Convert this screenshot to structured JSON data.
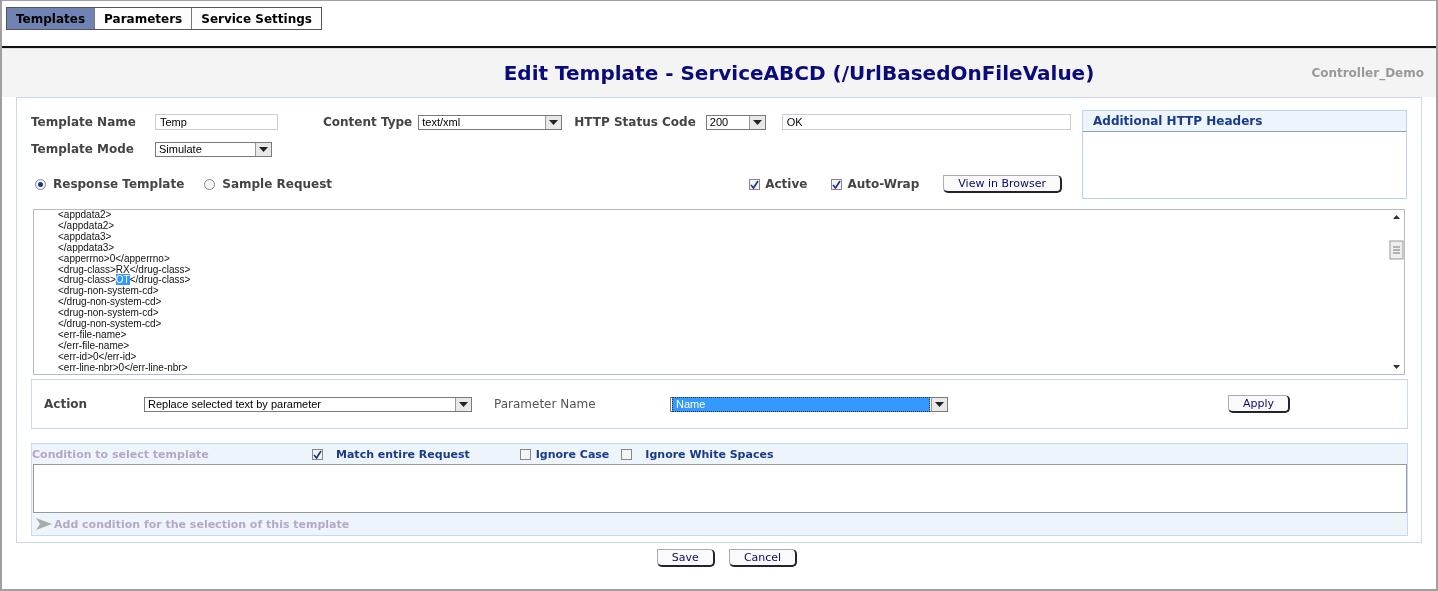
{
  "tabs": [
    {
      "label": "Templates",
      "selected": true
    },
    {
      "label": "Parameters",
      "selected": false
    },
    {
      "label": "Service Settings",
      "selected": false
    }
  ],
  "header": {
    "title": "Edit Template - ServiceABCD (/UrlBasedOnFileValue)",
    "app_name": "Controller_Demo"
  },
  "form": {
    "template_name": {
      "label": "Template Name",
      "value": "Temp"
    },
    "content_type": {
      "label": "Content Type",
      "value": "text/xml"
    },
    "http_status": {
      "label": "HTTP Status Code",
      "code": "200",
      "reason": "OK"
    },
    "template_mode": {
      "label": "Template Mode",
      "value": "Simulate"
    }
  },
  "mode_radios": [
    {
      "label": "Response Template",
      "selected": true
    },
    {
      "label": "Sample Request",
      "selected": false
    }
  ],
  "options": [
    {
      "label": "Active",
      "checked": true
    },
    {
      "label": "Auto-Wrap",
      "checked": true
    }
  ],
  "view_button": "View in Browser",
  "headers_panel": {
    "title": "Additional HTTP Headers"
  },
  "editor": {
    "lines": [
      {
        "parts": [
          {
            "text": "<appdata2>",
            "selected": false
          }
        ]
      },
      {
        "parts": [
          {
            "text": "</appdata2>",
            "selected": false
          }
        ]
      },
      {
        "parts": [
          {
            "text": "<appdata3>",
            "selected": false
          }
        ]
      },
      {
        "parts": [
          {
            "text": "</appdata3>",
            "selected": false
          }
        ]
      },
      {
        "parts": [
          {
            "text": "<apperrno>0</apperrno>",
            "selected": false
          }
        ]
      },
      {
        "parts": [
          {
            "text": "<drug-class>RX</drug-class>",
            "selected": false
          }
        ]
      },
      {
        "parts": [
          {
            "text": "<drug-class>",
            "selected": false
          },
          {
            "text": "OT",
            "selected": true
          },
          {
            "text": "</drug-class>",
            "selected": false
          }
        ]
      },
      {
        "parts": [
          {
            "text": "<drug-non-system-cd>",
            "selected": false
          }
        ]
      },
      {
        "parts": [
          {
            "text": "</drug-non-system-cd>",
            "selected": false
          }
        ]
      },
      {
        "parts": [
          {
            "text": "<drug-non-system-cd>",
            "selected": false
          }
        ]
      },
      {
        "parts": [
          {
            "text": "</drug-non-system-cd>",
            "selected": false
          }
        ]
      },
      {
        "parts": [
          {
            "text": "<err-file-name>",
            "selected": false
          }
        ]
      },
      {
        "parts": [
          {
            "text": "</err-file-name>",
            "selected": false
          }
        ]
      },
      {
        "parts": [
          {
            "text": "<err-id>0</err-id>",
            "selected": false
          }
        ]
      },
      {
        "parts": [
          {
            "text": "<err-line-nbr>0</err-line-nbr>",
            "selected": false
          }
        ]
      }
    ]
  },
  "action": {
    "label": "Action",
    "value": "Replace selected text by parameter",
    "parameter_label": "Parameter Name",
    "parameter_value": "Name",
    "parameter_focused": true,
    "apply_button": "Apply"
  },
  "condition": {
    "title": "Condition to select template",
    "options": [
      {
        "label": "Match entire Request",
        "checked": true
      },
      {
        "label": "Ignore Case",
        "checked": false
      },
      {
        "label": "Ignore White Spaces",
        "checked": false
      }
    ],
    "add_link": "Add condition for the selection of this template"
  },
  "buttons": [
    "Save",
    "Cancel"
  ]
}
